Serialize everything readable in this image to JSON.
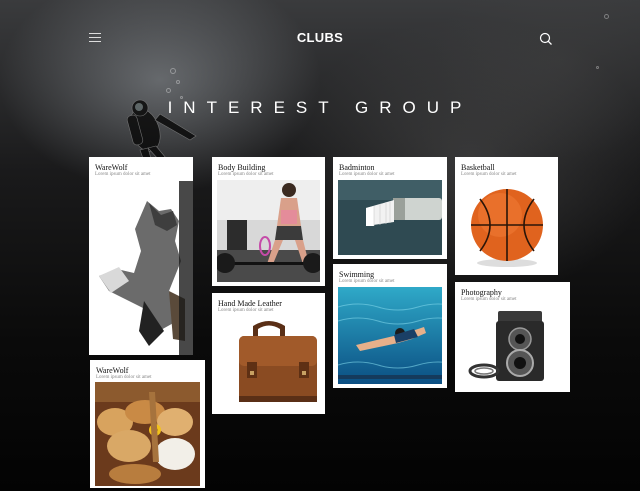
{
  "header": {
    "brand": "CLUBS",
    "menu_icon": "hamburger-menu-icon",
    "search_icon": "search-icon"
  },
  "section": {
    "heading": "INTEREST GROUP"
  },
  "cards": [
    {
      "title": "WareWolf",
      "subtitle": "Lorem ipsum dolor sit amet"
    },
    {
      "title": "Body Building",
      "subtitle": "Lorem ipsum dolor sit amet"
    },
    {
      "title": "Badminton",
      "subtitle": "Lorem ipsum dolor sit amet"
    },
    {
      "title": "Basketball",
      "subtitle": "Lorem ipsum dolor sit amet"
    },
    {
      "title": "Hand Made Leather",
      "subtitle": "Lorem ipsum dolor sit amet"
    },
    {
      "title": "Swimming",
      "subtitle": "Lorem ipsum dolor sit amet"
    },
    {
      "title": "Photography",
      "subtitle": "Lorem ipsum dolor sit amet"
    },
    {
      "title": "WareWolf",
      "subtitle": "Lorem ipsum dolor sit amet"
    }
  ],
  "colors": {
    "background": "#050505",
    "card": "#ffffff",
    "text_light": "#ffffff"
  }
}
